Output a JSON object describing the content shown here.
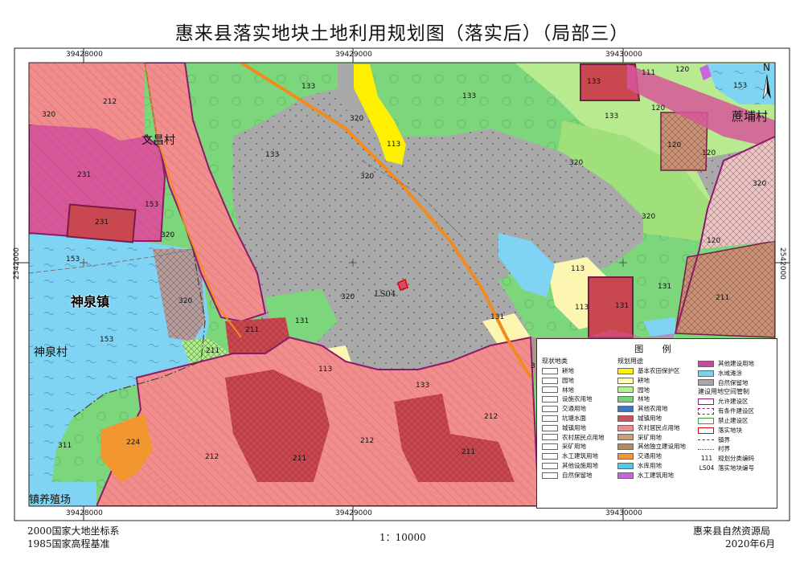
{
  "title": "惠来县落实地块土地利用规划图（落实后）（局部三）",
  "north_label": "N",
  "coords": {
    "top": [
      "39428000",
      "39429000",
      "39430000"
    ],
    "bottom": [
      "39428000",
      "39429000",
      "39430000"
    ],
    "left": "2542000",
    "right": "2542000"
  },
  "place_names": {
    "wenchang": "文昌村",
    "shenquan_town": "神泉镇",
    "shenquan_village": "神泉村",
    "zhepu": "蔗埔村",
    "yangzhi": "镇养殖场"
  },
  "plot_label": "LS04",
  "zone_codes": {
    "c212a": "212",
    "c320a": "320",
    "c231a": "231",
    "c231b": "231",
    "c153a": "153",
    "c320b": "320",
    "c153b": "153",
    "c320c": "320",
    "c153c": "153",
    "c211a": "211",
    "c211b": "211",
    "c224": "224",
    "c311": "311",
    "c212b": "212",
    "c211c": "211",
    "c212c": "212",
    "c211d": "211",
    "c212d": "212",
    "c133a": "133",
    "c133b": "133",
    "c133c": "133",
    "c320d": "320",
    "c320e": "320",
    "c113a": "113",
    "c320f": "320",
    "c320g": "320",
    "c131a": "131",
    "c113b": "113",
    "c133d": "133",
    "c131b": "131",
    "c133e": "133",
    "c111": "111",
    "c120a": "120",
    "c120b": "120",
    "c153d": "153",
    "c133f": "133",
    "c120c": "120",
    "c120d": "120",
    "c320h": "320",
    "c320i": "320",
    "c320j": "320",
    "c120e": "120",
    "c113c": "113",
    "c113d": "113",
    "c131c": "131",
    "c131d": "131",
    "c211e": "211",
    "c3x": "3"
  },
  "legend": {
    "title": "图 例",
    "status_title": "现状地类",
    "status_items": [
      "耕地",
      "园地",
      "林地",
      "设施农用地",
      "交通用地",
      "坑塘水面",
      "城镇用地",
      "农村居民点用地",
      "采矿用地",
      "水工建筑用地",
      "其他设施用地",
      "自然保留地"
    ],
    "plan_title": "规划用途",
    "plan_items": [
      {
        "label": "基本农田保护区",
        "color": "#fff200"
      },
      {
        "label": "耕地",
        "color": "#ffffb4"
      },
      {
        "label": "园地",
        "color": "#b4f08c"
      },
      {
        "label": "林地",
        "color": "#78d278"
      },
      {
        "label": "其他农用地",
        "color": "#3c78c8"
      },
      {
        "label": "城镇用地",
        "color": "#d2505a"
      },
      {
        "label": "农村居民点用地",
        "color": "#f08c8c"
      },
      {
        "label": "采矿用地",
        "color": "#c8a078"
      },
      {
        "label": "其他独立建设用地",
        "color": "#b48c64"
      },
      {
        "label": "交通用地",
        "color": "#f59632"
      },
      {
        "label": "水库用地",
        "color": "#50c8f0"
      },
      {
        "label": "水工建筑用地",
        "color": "#c864dc"
      }
    ],
    "other_items": [
      {
        "label": "其他建设用地",
        "color": "#c84b9b"
      },
      {
        "label": "水域滩涂",
        "color": "#78d2f0"
      },
      {
        "label": "自然保留地",
        "color": "#a8a8a8"
      }
    ],
    "control_title": "建设用地空间管制",
    "control_items": [
      "允许建设区",
      "有条件建设区",
      "禁止建设区",
      "落实地块"
    ],
    "line_items": [
      "镇界",
      "村界"
    ],
    "code_items": [
      {
        "code": "111",
        "label": "规划分类编码"
      },
      {
        "code": "LS04",
        "label": "落实地块编号"
      }
    ]
  },
  "footer": {
    "coord_system": "2000国家大地坐标系",
    "height_datum": "1985国家高程基准",
    "scale": "1：10000",
    "agency": "惠来县自然资源局",
    "date": "2020年6月"
  }
}
